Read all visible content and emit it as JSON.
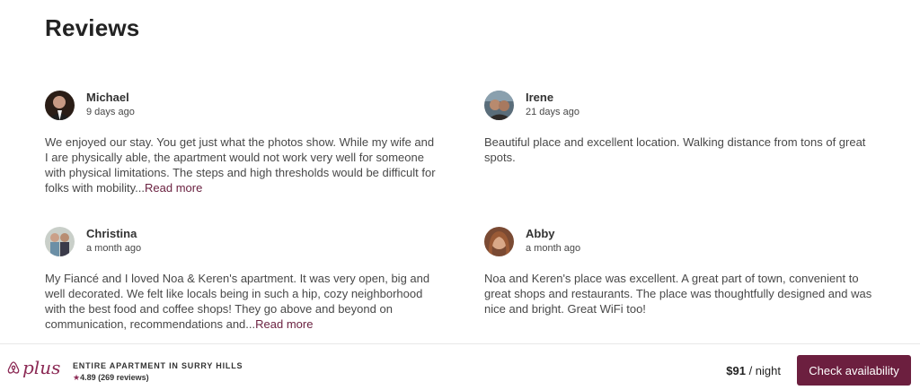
{
  "section": {
    "title": "Reviews"
  },
  "reviews": [
    {
      "name": "Michael",
      "date": "9 days ago",
      "text": "We enjoyed our stay. You get just what the photos show. While my wife and I are physically able, the apartment would not work very well for someone with physical limitations. The steps and high thresholds would be difficult for folks with mobility...",
      "read_more": "Read more"
    },
    {
      "name": "Irene",
      "date": "21 days ago",
      "text": "Beautiful place and excellent location. Walking distance from tons of great spots.",
      "read_more": ""
    },
    {
      "name": "Christina",
      "date": "a month ago",
      "text": "My Fiancé and I loved Noa & Keren's apartment. It was very open, big and well decorated. We felt like locals being in such a hip, cozy neighborhood with the best food and coffee shops! They go above and beyond on communication, recommendations and...",
      "read_more": "Read more"
    },
    {
      "name": "Abby",
      "date": "a month ago",
      "text": "Noa and Keren's place was excellent. A great part of town, convenient to great shops and restaurants. The place was thoughtfully designed and was nice and bright. Great WiFi too!",
      "read_more": ""
    }
  ],
  "footer": {
    "logo_text": "plus",
    "listing_type": "ENTIRE APARTMENT IN SURRY HILLS",
    "star": "★",
    "rating": "4.89 (269 reviews)",
    "price": "$91",
    "price_unit": " / night",
    "cta_label": "Check availability"
  },
  "colors": {
    "brand": "#6c1f3f",
    "link": "#6b2241"
  }
}
